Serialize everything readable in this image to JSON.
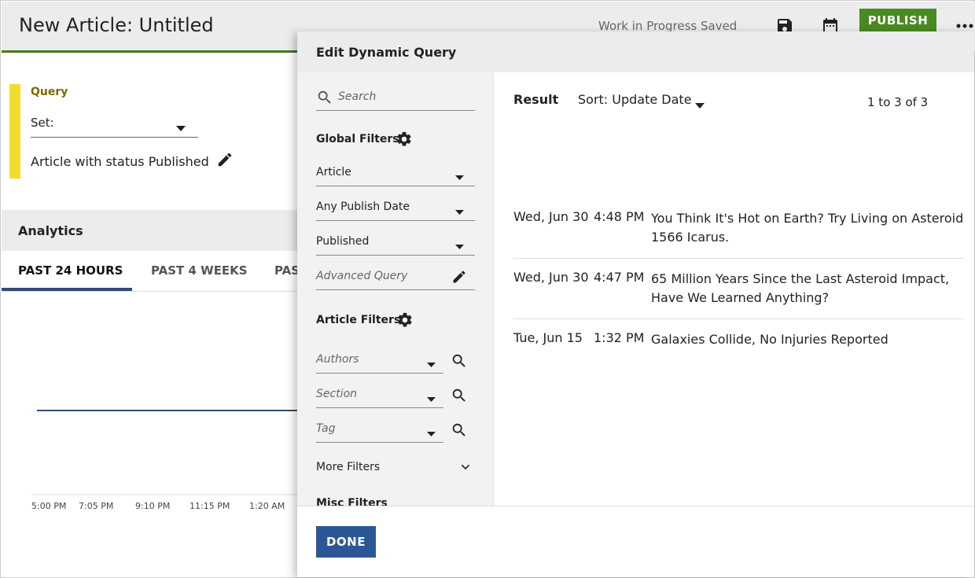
{
  "app": {
    "title": "New Article: Untitled",
    "status": "Work in Progress Saved",
    "publish_label": "PUBLISH",
    "accent": "#4a8a22"
  },
  "toolbar_icons": [
    "save-icon",
    "calendar-icon",
    "more-icon"
  ],
  "query": {
    "label": "Query",
    "set_value": "Set:",
    "summary": "Article with status Published"
  },
  "analytics": {
    "title": "Analytics",
    "tabs": [
      "PAST 24 HOURS",
      "PAST 4 WEEKS",
      "PAS"
    ],
    "active_tab": "PAST 24 HOURS",
    "x_ticks": [
      "5:00 PM",
      "7:05 PM",
      "9:10 PM",
      "11:15 PM",
      "1:20 AM"
    ]
  },
  "modal": {
    "title": "Edit Dynamic Query",
    "search_placeholder": "Search",
    "global_filters": {
      "title": "Global Filters",
      "type": "Article",
      "publish_date": "Any Publish Date",
      "status": "Published",
      "advanced": "Advanced Query"
    },
    "article_filters": {
      "title": "Article Filters",
      "authors": "Authors",
      "section": "Section",
      "tag": "Tag"
    },
    "more_filters": "More Filters",
    "misc_filters": "Misc Filters",
    "result_label": "Result",
    "sort_label": "Sort: Update Date",
    "paging": "1 to 3 of 3",
    "results": [
      {
        "date": "Wed, Jun 30",
        "time": "4:48 PM",
        "headline": "You Think It's Hot on Earth? Try Living on Asteroid 1566 Icarus."
      },
      {
        "date": "Wed, Jun 30",
        "time": "4:47 PM",
        "headline": "65 Million Years Since the Last Asteroid Impact, Have We Learned Anything?"
      },
      {
        "date": "Tue, Jun 15",
        "time": "1:32 PM",
        "headline": "Galaxies Collide, No Injuries Reported"
      }
    ],
    "done_label": "DONE",
    "done_color": "#2b5797"
  }
}
